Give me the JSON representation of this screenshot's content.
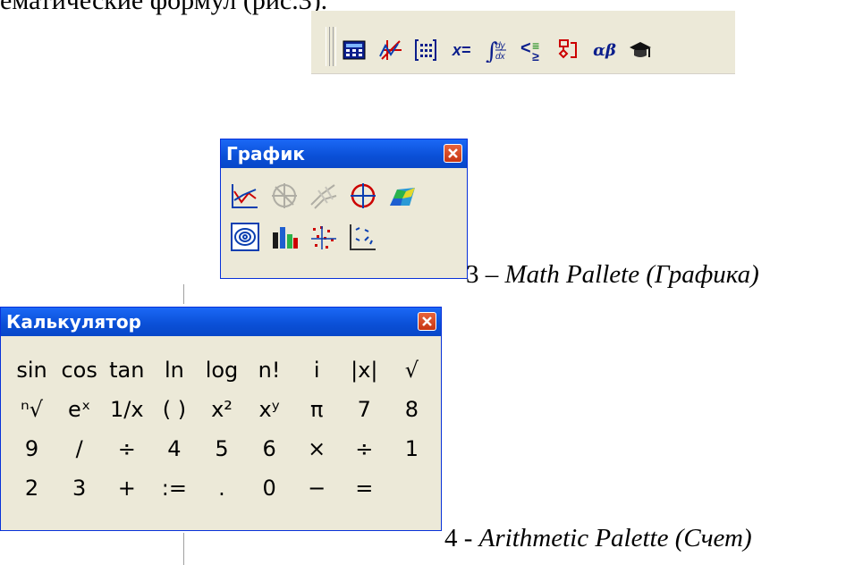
{
  "document": {
    "top_text": "ематические формул (рис.3).",
    "caption3_num": "3 – ",
    "caption3_text": "Math Pallete (Графика)",
    "caption4_num": "4 - ",
    "caption4_text": "Arithmetic Palette (Счет)"
  },
  "toolbar": {
    "icons": [
      "calculator-icon",
      "graph-icon",
      "matrix-icon",
      "evaluation-icon",
      "calculus-icon",
      "boolean-icon",
      "programming-icon",
      "greek-icon",
      "symbolic-icon"
    ],
    "evaluation_label": "x=",
    "greek_label": "αβ"
  },
  "graph_palette": {
    "title": "График",
    "icons": [
      "xy-plot-icon",
      "polar-plot-icon",
      "surface-plot-icon",
      "polar-circle-icon",
      "3d-surface-icon",
      "contour-plot-icon",
      "3d-bar-icon",
      "scatter-3d-icon",
      "vector-field-icon"
    ]
  },
  "calculator": {
    "title": "Калькулятор",
    "keys": [
      "sin",
      "cos",
      "tan",
      "ln",
      "log",
      "n!",
      "i",
      "|x|",
      "√",
      "ⁿ√",
      "eˣ",
      "1/x",
      "( )",
      "x²",
      "xʸ",
      "π",
      "7",
      "8",
      "9",
      "/",
      "÷",
      "4",
      "5",
      "6",
      "×",
      "÷",
      "1",
      "2",
      "3",
      "+",
      ":=",
      ".",
      "0",
      "−",
      "="
    ]
  },
  "colors": {
    "title_bar": "#0a4fd6",
    "window_bg": "#ece9d8",
    "close_button": "#d8461f"
  }
}
